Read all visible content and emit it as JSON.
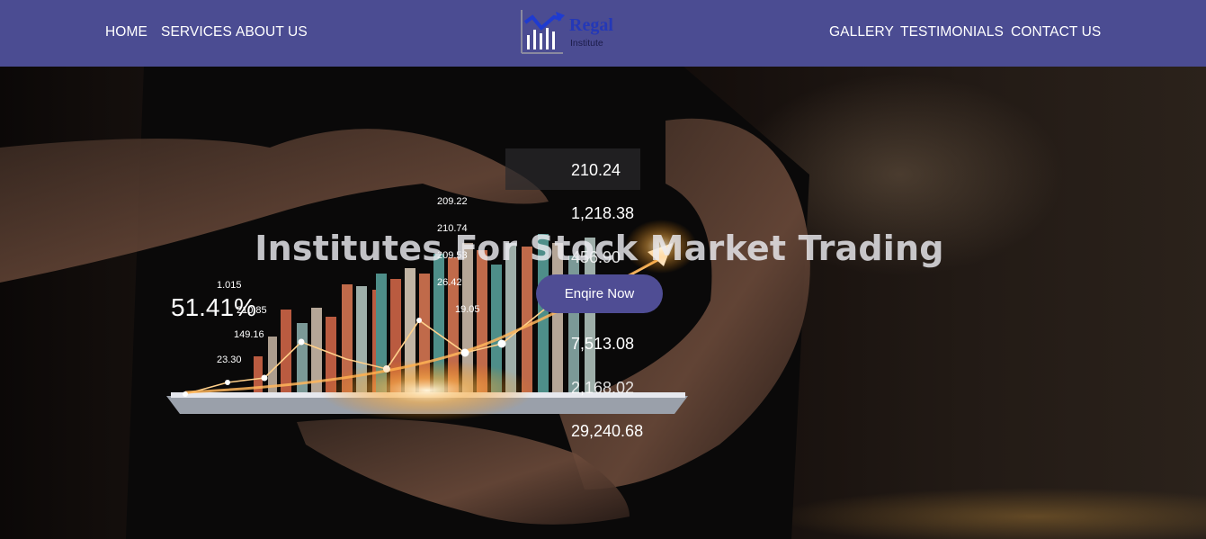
{
  "nav": {
    "left": [
      "HOME",
      "SERVICES",
      "ABOUT US"
    ],
    "right": [
      "GALLERY",
      "TESTIMONIALS",
      "CONTACT US"
    ]
  },
  "logo": {
    "title": "Regal",
    "subtitle": "Institute",
    "icon": "chart-arrow-icon"
  },
  "hero": {
    "title": "Institutes For Stock Market Trading",
    "cta_label": "Enqire Now",
    "bg_numbers": {
      "right_column": [
        "210.24",
        "1,218.38",
        "456.90",
        "7,513.08",
        "2,168.02",
        "29,240.68"
      ],
      "percent": "51.41%",
      "small": [
        "209.22",
        "210.74",
        "209.53",
        "26.42",
        "19.05",
        "1.015",
        "210.85",
        "149.16",
        "23.30"
      ]
    }
  },
  "colors": {
    "nav_bg": "#4b4c92",
    "cta_bg": "#4f4d94",
    "logo_text": "#2438b7"
  }
}
